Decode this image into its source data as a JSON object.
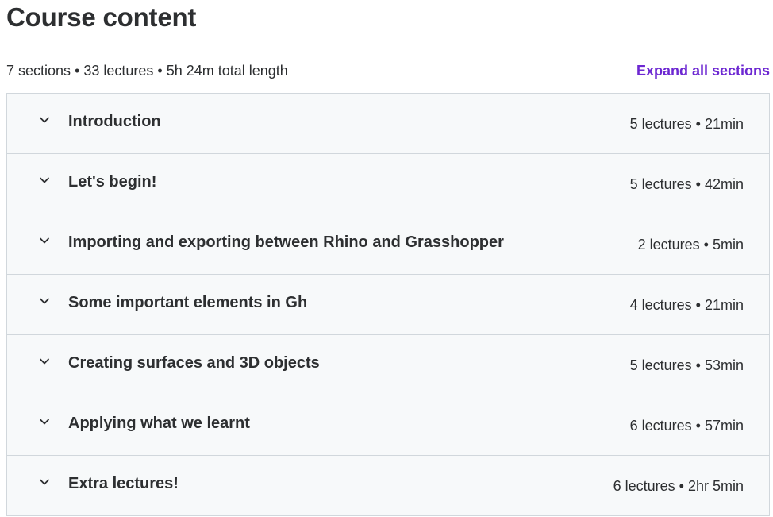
{
  "page": {
    "title": "Course content"
  },
  "summary": {
    "text": "7 sections • 33 lectures • 5h 24m total length",
    "expand_label": "Expand all sections"
  },
  "colors": {
    "accent": "#6d28d2",
    "section_bg": "#f7f9fa",
    "border": "#d1d7dc",
    "text": "#2d2f31"
  },
  "sections": [
    {
      "title": "Introduction",
      "meta": "5 lectures • 21min",
      "icon": "chevron-down-icon"
    },
    {
      "title": "Let's begin!",
      "meta": "5 lectures • 42min",
      "icon": "chevron-down-icon"
    },
    {
      "title": "Importing and exporting between Rhino and Grasshopper",
      "meta": "2 lectures • 5min",
      "icon": "chevron-down-icon"
    },
    {
      "title": "Some important elements in Gh",
      "meta": "4 lectures • 21min",
      "icon": "chevron-down-icon"
    },
    {
      "title": "Creating surfaces and 3D objects",
      "meta": "5 lectures • 53min",
      "icon": "chevron-down-icon"
    },
    {
      "title": "Applying what we learnt",
      "meta": "6 lectures • 57min",
      "icon": "chevron-down-icon"
    },
    {
      "title": "Extra lectures!",
      "meta": "6 lectures • 2hr 5min",
      "icon": "chevron-down-icon"
    }
  ]
}
